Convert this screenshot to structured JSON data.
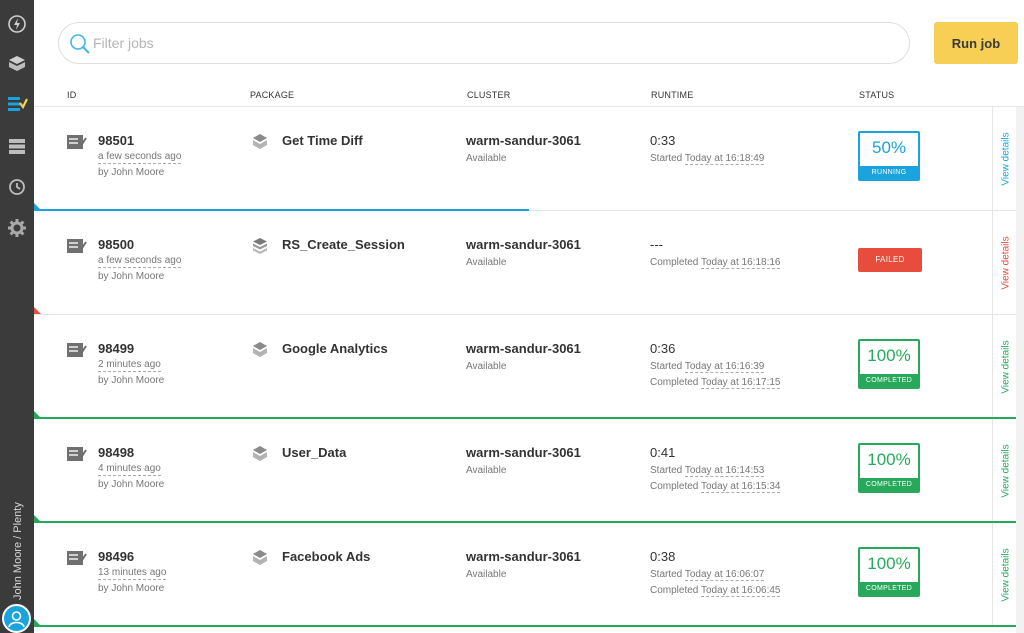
{
  "search": {
    "placeholder": "Filter jobs"
  },
  "run_button": "Run job",
  "columns": {
    "id": "ID",
    "package": "PACKAGE",
    "cluster": "CLUSTER",
    "runtime": "RUNTIME",
    "status": "STATUS"
  },
  "sidebar": {
    "user": "John Moore / Plenty"
  },
  "colors": {
    "running": "#1aa3dc",
    "failed": "#e74c3c",
    "completed": "#27a85a",
    "accent": "#f8cf55"
  },
  "jobs": [
    {
      "id": "98501",
      "ago": "a few seconds ago",
      "by": "by John Moore",
      "package": "Get Time Diff",
      "cluster": "warm-sandur-3061",
      "cluster_status": "Available",
      "runtime": "0:33",
      "line1_prefix": "Started",
      "line1_time": "Today at 16:18:49",
      "line2_prefix": "",
      "line2_time": "",
      "status": "running",
      "percent": "50%",
      "status_label": "RUNNING",
      "progress": 0.5,
      "view": "View details"
    },
    {
      "id": "98500",
      "ago": "a few seconds ago",
      "by": "by John Moore",
      "package": "RS_Create_Session",
      "cluster": "warm-sandur-3061",
      "cluster_status": "Available",
      "runtime": "---",
      "line1_prefix": "Completed",
      "line1_time": "Today at 16:18:16",
      "line2_prefix": "",
      "line2_time": "",
      "status": "failed",
      "percent": "",
      "status_label": "FAILED",
      "progress": 0,
      "view": "View details"
    },
    {
      "id": "98499",
      "ago": "2 minutes ago",
      "by": "by John Moore",
      "package": "Google Analytics",
      "cluster": "warm-sandur-3061",
      "cluster_status": "Available",
      "runtime": "0:36",
      "line1_prefix": "Started",
      "line1_time": "Today at 16:16:39",
      "line2_prefix": "Completed",
      "line2_time": "Today at 16:17:15",
      "status": "completed",
      "percent": "100%",
      "status_label": "COMPLETED",
      "progress": 1,
      "view": "View details"
    },
    {
      "id": "98498",
      "ago": "4 minutes ago",
      "by": "by John Moore",
      "package": "User_Data",
      "cluster": "warm-sandur-3061",
      "cluster_status": "Available",
      "runtime": "0:41",
      "line1_prefix": "Started",
      "line1_time": "Today at 16:14:53",
      "line2_prefix": "Completed",
      "line2_time": "Today at 16:15:34",
      "status": "completed",
      "percent": "100%",
      "status_label": "COMPLETED",
      "progress": 1,
      "view": "View details"
    },
    {
      "id": "98496",
      "ago": "13 minutes ago",
      "by": "by John Moore",
      "package": "Facebook Ads",
      "cluster": "warm-sandur-3061",
      "cluster_status": "Available",
      "runtime": "0:38",
      "line1_prefix": "Started",
      "line1_time": "Today at 16:06:07",
      "line2_prefix": "Completed",
      "line2_time": "Today at 16:06:45",
      "status": "completed",
      "percent": "100%",
      "status_label": "COMPLETED",
      "progress": 1,
      "view": "View details"
    }
  ]
}
